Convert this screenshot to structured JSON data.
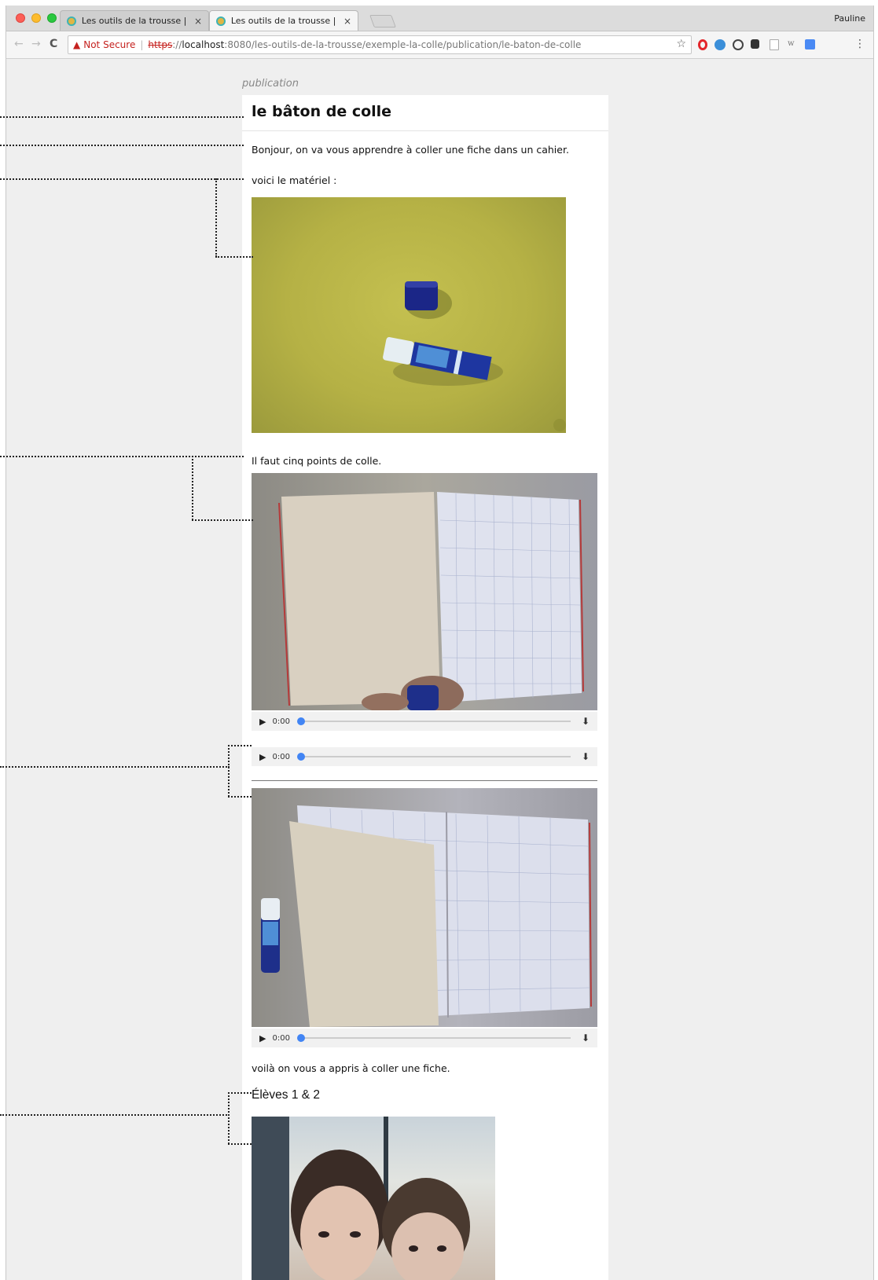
{
  "browser": {
    "tabs": [
      {
        "title": "Les outils de la trousse | Exem",
        "active": false
      },
      {
        "title": "Les outils de la trousse | Exem",
        "active": true
      }
    ],
    "close_glyph": "×",
    "profile": "Pauline",
    "nav": {
      "back": "←",
      "forward": "→",
      "reload": "C"
    },
    "address": {
      "warning_glyph": "▲",
      "security_label": "Not Secure",
      "separator": "|",
      "scheme": "https",
      "scheme_sep": "://",
      "host": "localhost",
      "rest": ":8080/les-outils-de-la-trousse/exemple-la-colle/publication/le-baton-de-colle"
    },
    "star_glyph": "☆",
    "menu_glyph": "⋮",
    "extensions": [
      "opera-icon",
      "extension-blue-icon",
      "search-ext-icon",
      "d-ext-icon",
      "page-ext-icon",
      "wikipedia-icon",
      "translate-icon"
    ]
  },
  "page": {
    "section_label": "publication",
    "title": "le bâton de colle",
    "intro": "Bonjour, on va vous apprendre à coller une fiche dans un cahier.",
    "materials": "voici le matériel :",
    "points": "Il faut cinq points de colle.",
    "outro": "voilà on vous a appris à coller une fiche.",
    "authors": "Élèves 1 & 2"
  },
  "media": {
    "players": [
      {
        "time": "0:00",
        "play": "▶",
        "download": "⬇",
        "progress": 0
      },
      {
        "time": "0:00",
        "play": "▶",
        "download": "⬇",
        "progress": 0
      },
      {
        "time": "0:00",
        "play": "▶",
        "download": "⬇",
        "progress": 0
      }
    ]
  },
  "colors": {
    "page_bg": "#efefef",
    "card_bg": "#ffffff",
    "insecure_red": "#c5221f",
    "player_knob": "#4285f4",
    "glue_stick_blue": "#1d2a8c",
    "table_yellow": "#b9b44a"
  }
}
